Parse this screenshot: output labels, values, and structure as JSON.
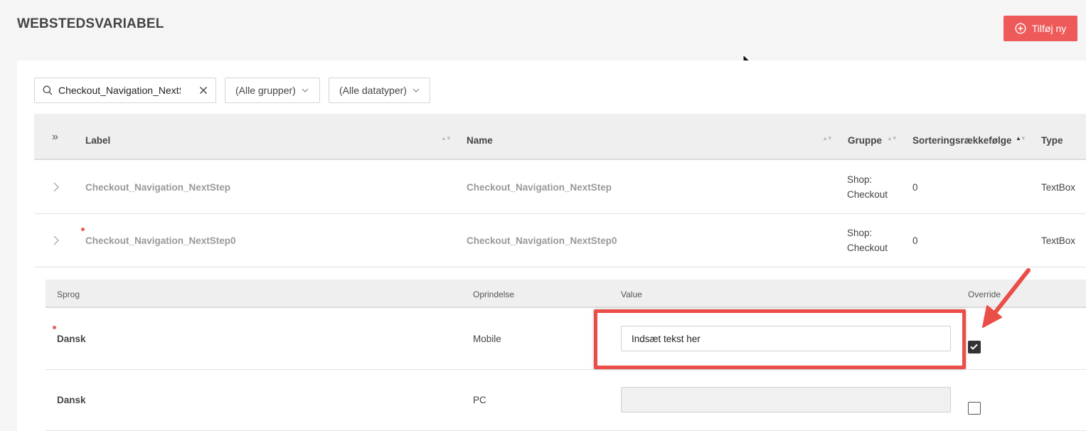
{
  "header": {
    "title": "WEBSTEDSVARIABEL",
    "add_button_label": "Tilføj ny"
  },
  "filters": {
    "search_value": "Checkout_Navigation_NextS",
    "group_dropdown": "(Alle grupper)",
    "datatype_dropdown": "(Alle datatyper)"
  },
  "table": {
    "columns": [
      "Label",
      "Name",
      "Gruppe",
      "Sorteringsrækkefølge",
      "Type"
    ],
    "rows": [
      {
        "label": "Checkout_Navigation_NextStep",
        "name": "Checkout_Navigation_NextStep",
        "group_line1": "Shop:",
        "group_line2": "Checkout",
        "sort": "0",
        "type": "TextBox"
      },
      {
        "label": "Checkout_Navigation_NextStep0",
        "name": "Checkout_Navigation_NextStep0",
        "group_line1": "Shop:",
        "group_line2": "Checkout",
        "sort": "0",
        "type": "TextBox"
      }
    ]
  },
  "subtable": {
    "columns": [
      "Sprog",
      "Oprindelse",
      "Value",
      "Override"
    ],
    "rows": [
      {
        "language": "Dansk",
        "origin": "Mobile",
        "value": "Indsæt tekst her",
        "override": true
      },
      {
        "language": "Dansk",
        "origin": "PC",
        "value": "",
        "override": false
      }
    ]
  },
  "colors": {
    "accent": "#ee5a5a",
    "annotation": "#ea4e47"
  }
}
